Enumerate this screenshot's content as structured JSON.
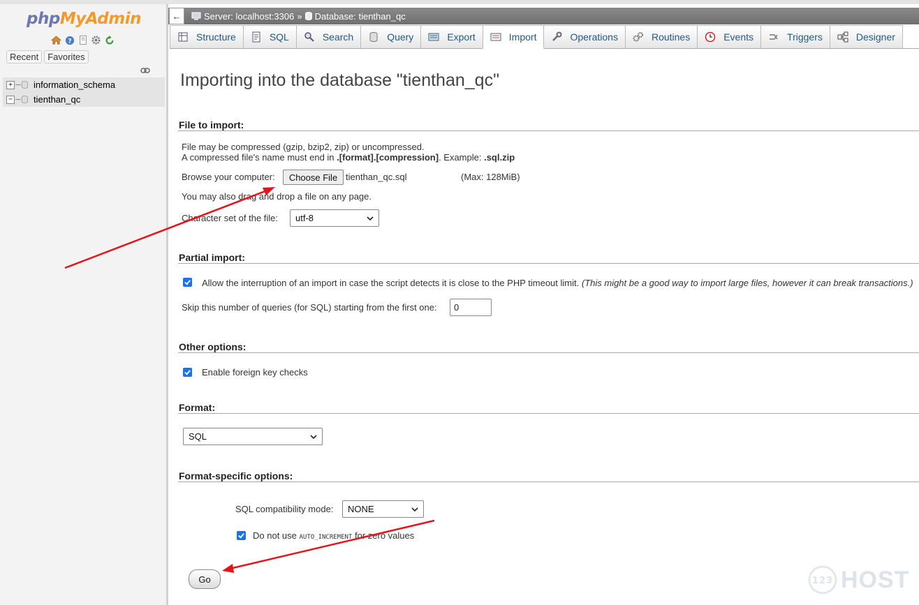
{
  "sidebar": {
    "logo_php": "php",
    "logo_my": "MyAdmin",
    "icons": [
      "home-icon",
      "help-icon",
      "docs-icon",
      "settings-icon",
      "reload-icon"
    ],
    "recent_label": "Recent",
    "favorites_label": "Favorites",
    "databases": [
      {
        "name": "information_schema",
        "expander": "+"
      },
      {
        "name": "tienthan_qc",
        "expander": "−"
      }
    ]
  },
  "breadcrumb": {
    "server": "Server: localhost:3306",
    "separator": "»",
    "database": "Database: tienthan_qc"
  },
  "tabs": [
    {
      "label": "Structure",
      "icon": "structure-icon"
    },
    {
      "label": "SQL",
      "icon": "sql-icon"
    },
    {
      "label": "Search",
      "icon": "search-icon"
    },
    {
      "label": "Query",
      "icon": "query-icon"
    },
    {
      "label": "Export",
      "icon": "export-icon"
    },
    {
      "label": "Import",
      "icon": "import-icon",
      "active": true
    },
    {
      "label": "Operations",
      "icon": "wrench-icon"
    },
    {
      "label": "Routines",
      "icon": "routines-icon"
    },
    {
      "label": "Events",
      "icon": "clock-icon"
    },
    {
      "label": "Triggers",
      "icon": "triggers-icon"
    },
    {
      "label": "Designer",
      "icon": "designer-icon"
    }
  ],
  "page_title": "Importing into the database \"tienthan_qc\"",
  "file_to_import": {
    "legend": "File to import:",
    "line1": "File may be compressed (gzip, bzip2, zip) or uncompressed.",
    "line2_a": "A compressed file's name must end in ",
    "line2_b": ".[format].[compression]",
    "line2_c": ". Example: ",
    "line2_d": ".sql.zip",
    "browse_label": "Browse your computer:",
    "choose_file_label": "Choose File",
    "file_name": "tienthan_qc.sql",
    "max_size": "(Max: 128MiB)",
    "drag_text": "You may also drag and drop a file on any page.",
    "charset_label": "Character set of the file:",
    "charset_value": "utf-8"
  },
  "partial_import": {
    "legend": "Partial import:",
    "allow_interrupt_text": "Allow the interruption of an import in case the script detects it is close to the PHP timeout limit.",
    "allow_interrupt_note": "(This might be a good way to import large files, however it can break transactions.)",
    "skip_label": "Skip this number of queries (for SQL) starting from the first one:",
    "skip_value": "0"
  },
  "other_options": {
    "legend": "Other options:",
    "foreign_key_label": "Enable foreign key checks"
  },
  "format": {
    "legend": "Format:",
    "value": "SQL"
  },
  "format_specific": {
    "legend": "Format-specific options:",
    "compat_label": "SQL compatibility mode:",
    "compat_value": "NONE",
    "auto_inc_a": "Do not use ",
    "auto_inc_code": "AUTO_INCREMENT",
    "auto_inc_b": " for zero values"
  },
  "go_label": "Go",
  "watermark": {
    "badge": "123",
    "text": "HOST"
  },
  "colors": {
    "link": "#235a81",
    "checkbox": "#1a73e8",
    "arrow": "#e8131a"
  }
}
